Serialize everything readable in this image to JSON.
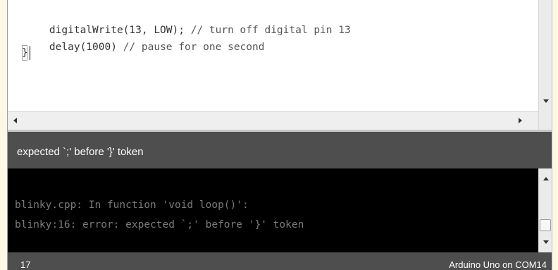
{
  "editor": {
    "lines": [
      {
        "code": "digitalWrite(13, LOW); ",
        "comment": "// turn off digital pin 13"
      },
      {
        "code": "delay(1000) ",
        "comment": "// pause for one second"
      }
    ],
    "closing_brace": "}"
  },
  "status": {
    "message": "expected `;' before '}' token"
  },
  "console": {
    "lines": [
      "blinky.cpp: In function 'void loop()':",
      "blinky:16: error: expected `;' before '}' token"
    ]
  },
  "footer": {
    "line_number": "17",
    "board": "Arduino Uno on COM14"
  },
  "icons": {
    "scroll_up": "arrow-up-icon",
    "scroll_down": "arrow-down-icon",
    "scroll_left": "arrow-left-icon",
    "scroll_right": "arrow-right-icon"
  },
  "colors": {
    "status_bar": "#4e4e4e",
    "console_bg": "#000000",
    "console_text": "#7a7a7a",
    "frame_bg": "#fdf8e4"
  }
}
